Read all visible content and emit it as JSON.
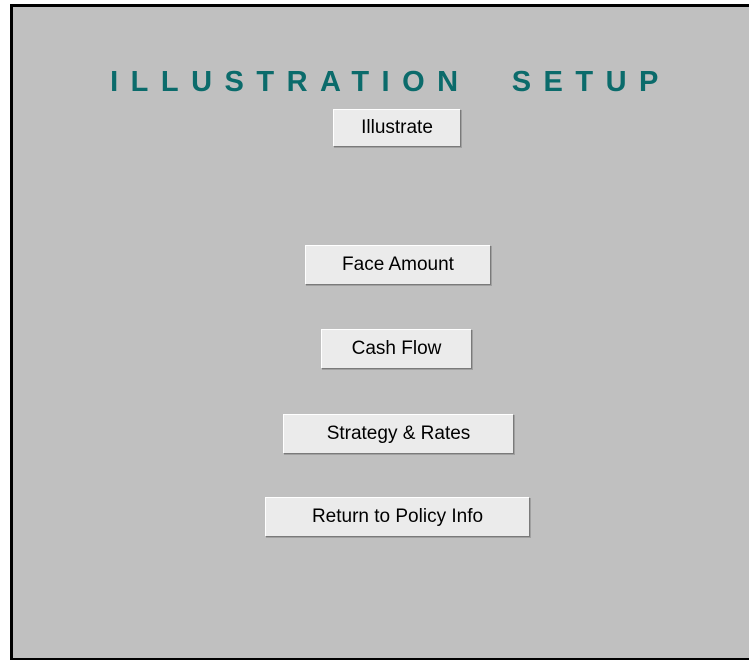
{
  "header": {
    "title": "ILLUSTRATION  SETUP"
  },
  "actions": {
    "illustrate_label": "Illustrate",
    "face_amount_label": "Face Amount",
    "cash_flow_label": "Cash Flow",
    "strategy_rates_label": "Strategy & Rates",
    "return_label": "Return to Policy Info"
  },
  "colors": {
    "panel_background": "#c0c0c0",
    "title_color": "#0b6b6b",
    "button_face": "#ebebeb"
  }
}
